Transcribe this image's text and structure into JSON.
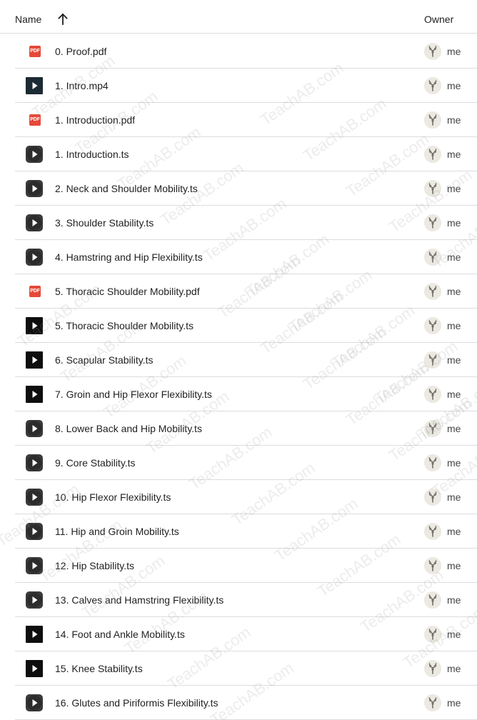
{
  "header": {
    "name_label": "Name",
    "sort_icon": "arrow-upward-icon",
    "owner_label": "Owner"
  },
  "files": [
    {
      "name": "0. Proof.pdf",
      "type": "pdf",
      "owner": "me"
    },
    {
      "name": "1. Intro.mp4",
      "type": "video-dark",
      "owner": "me"
    },
    {
      "name": "1. Introduction.pdf",
      "type": "pdf",
      "owner": "me"
    },
    {
      "name": "1. Introduction.ts",
      "type": "video-gray",
      "owner": "me"
    },
    {
      "name": "2. Neck and Shoulder Mobility.ts",
      "type": "video-gray",
      "owner": "me"
    },
    {
      "name": "3. Shoulder Stability.ts",
      "type": "video-gray",
      "owner": "me"
    },
    {
      "name": "4. Hamstring and Hip Flexibility.ts",
      "type": "video-gray",
      "owner": "me"
    },
    {
      "name": "5. Thoracic Shoulder Mobility.pdf",
      "type": "pdf",
      "owner": "me"
    },
    {
      "name": "5. Thoracic Shoulder Mobility.ts",
      "type": "video-black",
      "owner": "me"
    },
    {
      "name": "6. Scapular Stability.ts",
      "type": "video-black",
      "owner": "me"
    },
    {
      "name": "7. Groin and Hip Flexor Flexibility.ts",
      "type": "video-black",
      "owner": "me"
    },
    {
      "name": "8. Lower Back and Hip Mobility.ts",
      "type": "video-gray",
      "owner": "me"
    },
    {
      "name": "9. Core Stability.ts",
      "type": "video-gray",
      "owner": "me"
    },
    {
      "name": "10. Hip Flexor Flexibility.ts",
      "type": "video-gray",
      "owner": "me"
    },
    {
      "name": "11. Hip and Groin Mobility.ts",
      "type": "video-gray",
      "owner": "me"
    },
    {
      "name": "12. Hip Stability.ts",
      "type": "video-gray",
      "owner": "me"
    },
    {
      "name": "13. Calves and Hamstring Flexibility.ts",
      "type": "video-gray",
      "owner": "me"
    },
    {
      "name": "14. Foot and Ankle Mobility.ts",
      "type": "video-black",
      "owner": "me"
    },
    {
      "name": "15. Knee Stability.ts",
      "type": "video-black",
      "owner": "me"
    },
    {
      "name": "16. Glutes and Piriformis Flexibility.ts",
      "type": "video-gray",
      "owner": "me"
    }
  ],
  "pdf_badge": "PDF",
  "watermark_text": "TeachAB.com",
  "colors": {
    "pdf_red": "#e5493a",
    "video_dark": "#1b2a33",
    "video_gray": "#3a3a3a",
    "video_black": "#0e0e0e",
    "divider": "#dadce0",
    "avatar_bg": "#ece9e2"
  }
}
